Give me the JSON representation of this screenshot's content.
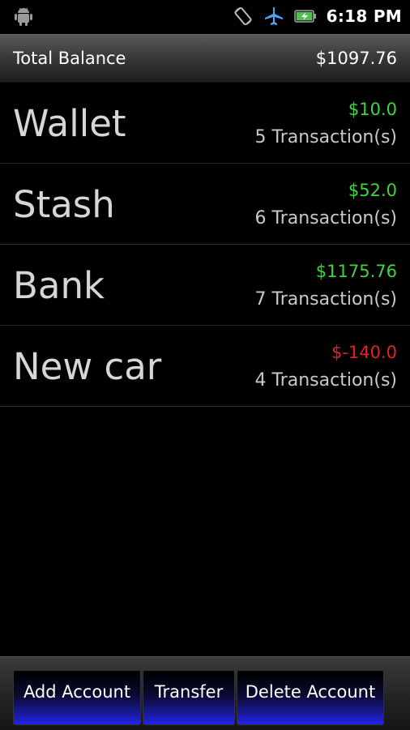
{
  "status_bar": {
    "time": "6:18 PM",
    "icons": [
      "android-icon",
      "rotate-icon",
      "airplane-icon",
      "battery-charging-icon"
    ]
  },
  "total": {
    "label": "Total Balance",
    "value": "$1097.76"
  },
  "accounts": [
    {
      "name": "Wallet",
      "amount": "$10.0",
      "transactions": "5 Transaction(s)",
      "sign": "positive"
    },
    {
      "name": "Stash",
      "amount": "$52.0",
      "transactions": "6 Transaction(s)",
      "sign": "positive"
    },
    {
      "name": "Bank",
      "amount": "$1175.76",
      "transactions": "7 Transaction(s)",
      "sign": "positive"
    },
    {
      "name": "New car",
      "amount": "$-140.0",
      "transactions": "4 Transaction(s)",
      "sign": "negative"
    }
  ],
  "buttons": {
    "add": "Add Account",
    "transfer": "Transfer",
    "delete": "Delete Account"
  },
  "colors": {
    "positive": "#3fd43f",
    "negative": "#e02424",
    "button_accent": "#2222ee"
  }
}
